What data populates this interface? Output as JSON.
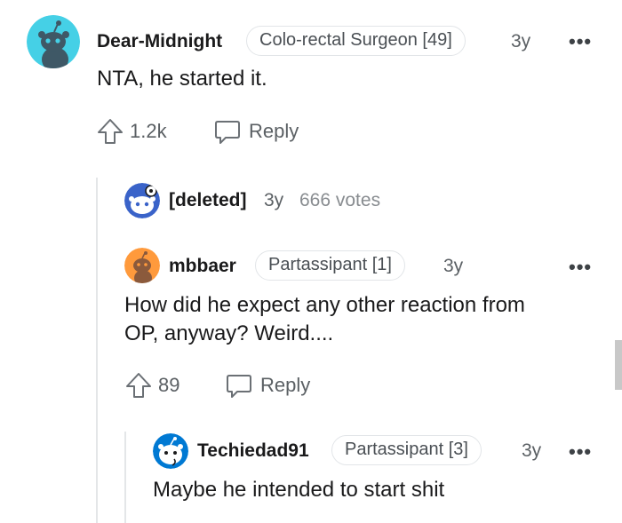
{
  "comments": [
    {
      "username": "Dear-Midnight",
      "flair": "Colo-rectal Surgeon [49]",
      "age": "3y",
      "body": "NTA, he started it.",
      "upvotes": "1.2k",
      "reply_label": "Reply",
      "more": "•••",
      "avatar_color": "#24a0ed"
    },
    {
      "username": "[deleted]",
      "age": "3y",
      "votes": "666 votes"
    },
    {
      "username": "mbbaer",
      "flair": "Partassipant [1]",
      "age": "3y",
      "body_line1": "How did he expect any other reaction from",
      "body_line2": "OP, anyway? Weird....",
      "upvotes": "89",
      "reply_label": "Reply",
      "more": "•••",
      "avatar_color": "#ff8717"
    },
    {
      "username": "Techiedad91",
      "flair": "Partassipant [3]",
      "age": "3y",
      "body": "Maybe he intended to start shit",
      "more": "•••",
      "avatar_color": "#0079d3"
    }
  ],
  "colors": {
    "text": "#1a1a1b",
    "meta": "#5b6064",
    "thread_line": "#e4e6e8",
    "flair_border": "#e2e5e8"
  }
}
